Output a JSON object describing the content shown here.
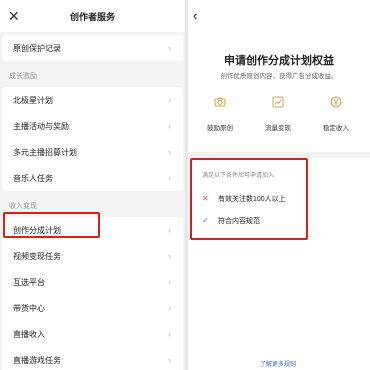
{
  "left": {
    "title": "创作者服务",
    "close_icon": "close-icon",
    "top_items": [
      {
        "label": "原创保护记录"
      }
    ],
    "groups": [
      {
        "label": "成长激励",
        "items": [
          {
            "label": "北极星计划"
          },
          {
            "label": "主播活动与奖励"
          },
          {
            "label": "多元主播招募计划"
          },
          {
            "label": "音乐人任务"
          }
        ]
      },
      {
        "label": "收入变现",
        "items": [
          {
            "label": "创作分成计划"
          },
          {
            "label": "视频变现任务"
          },
          {
            "label": "互选平台"
          },
          {
            "label": "带货中心"
          },
          {
            "label": "直播收入"
          },
          {
            "label": "直播游戏任务"
          }
        ]
      }
    ],
    "highlighted_item": "创作分成计划"
  },
  "right": {
    "back_icon": "back-arrow-icon",
    "title": "申请创作分成计划权益",
    "subtitle": "创作优质原创内容，获得广告分成收益。",
    "benefits": [
      {
        "label": "鼓励原创",
        "icon": "camera-icon"
      },
      {
        "label": "流量变现",
        "icon": "chart-icon"
      },
      {
        "label": "稳定收入",
        "icon": "coin-icon"
      }
    ],
    "conditions": {
      "heading": "满足以下条件后可申请加入",
      "items": [
        {
          "text": "有效关注数100人以上",
          "met": false
        },
        {
          "text": "符合内容规范",
          "met": true
        }
      ]
    },
    "more_link": "了解更多规则"
  },
  "colors": {
    "highlight": "#d9201a",
    "accent": "#d4a24c",
    "fail": "#e24a3b",
    "pass": "#2aa34a",
    "link": "#3a6cc8"
  }
}
